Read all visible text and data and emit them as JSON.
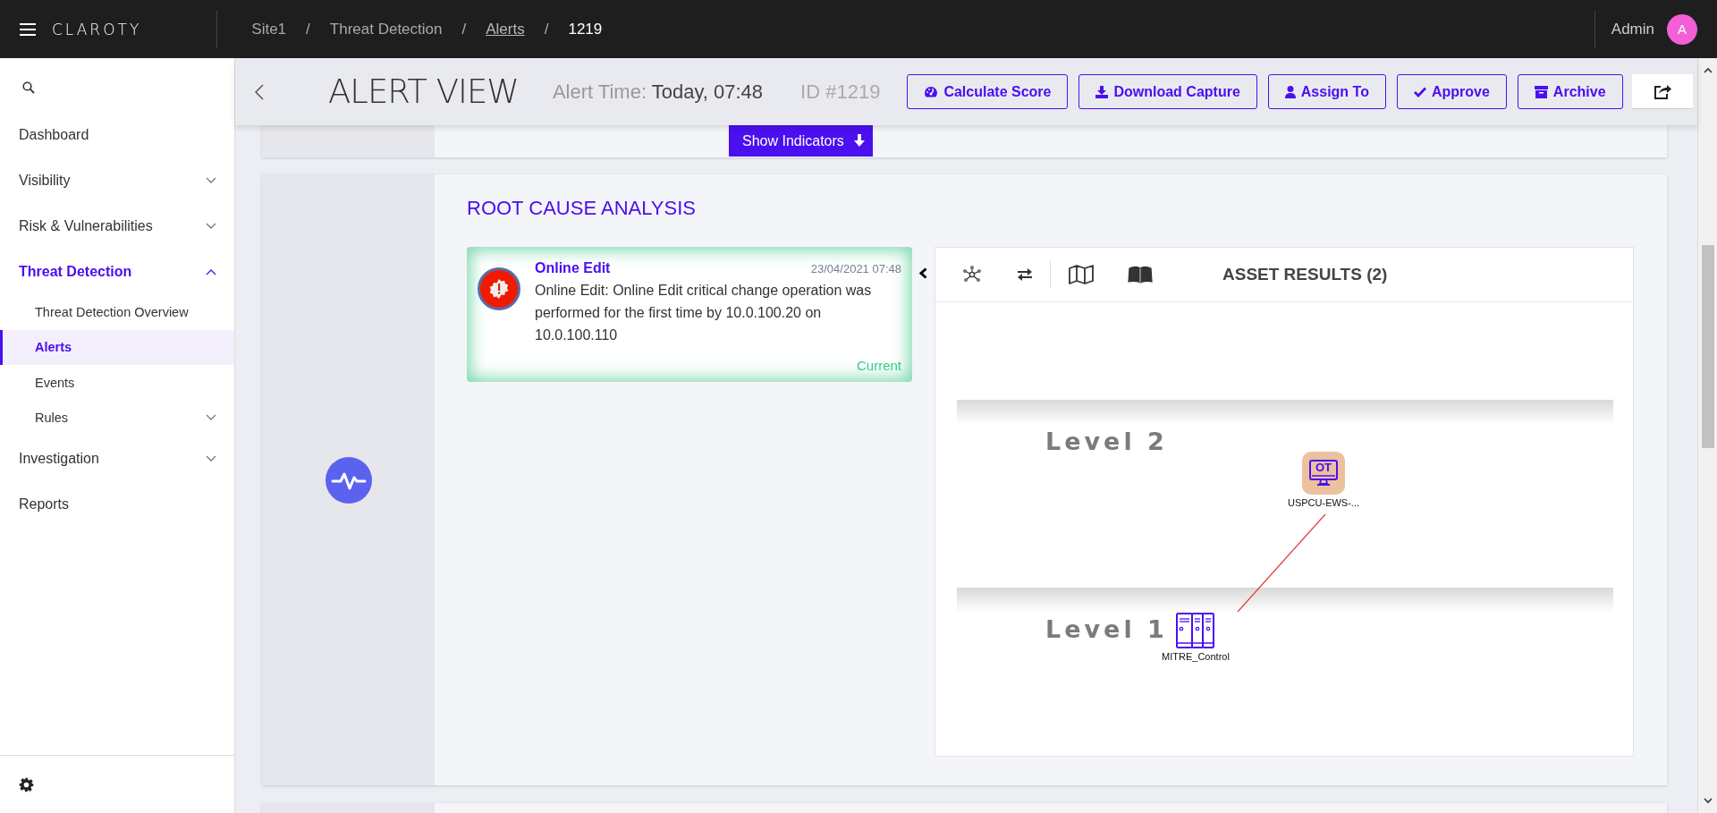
{
  "top_bar": {
    "logo": "CLAROTY",
    "separator": "/",
    "breadcrumbs": [
      {
        "label": "Site1",
        "kind": "text"
      },
      {
        "label": "Threat Detection",
        "kind": "text"
      },
      {
        "label": "Alerts",
        "kind": "link"
      },
      {
        "label": "1219",
        "kind": "current"
      }
    ],
    "user": {
      "name": "Admin",
      "initial": "A"
    }
  },
  "sidebar": {
    "items": [
      {
        "label": "Dashboard",
        "kind": "link",
        "selected": false
      },
      {
        "label": "Visibility",
        "kind": "group",
        "selected": false,
        "expanded": false
      },
      {
        "label": "Risk & Vulnerabilities",
        "kind": "group",
        "selected": false,
        "expanded": false
      },
      {
        "label": "Threat Detection",
        "kind": "group",
        "selected": true,
        "expanded": true,
        "children": [
          {
            "label": "Threat Detection Overview",
            "kind": "link",
            "selected": false
          },
          {
            "label": "Alerts",
            "kind": "link",
            "selected": true
          },
          {
            "label": "Events",
            "kind": "link",
            "selected": false
          },
          {
            "label": "Rules",
            "kind": "group",
            "selected": false,
            "expanded": false
          }
        ]
      },
      {
        "label": "Investigation",
        "kind": "group",
        "selected": false,
        "expanded": false
      },
      {
        "label": "Reports",
        "kind": "link",
        "selected": false
      }
    ]
  },
  "header": {
    "title": "ALERT VIEW",
    "time_label": "Alert Time:",
    "time_value": "Today, 07:48",
    "id": "ID #1219",
    "actions": [
      {
        "label": "Calculate Score",
        "kind": "gauge"
      },
      {
        "label": "Download Capture",
        "kind": "download"
      },
      {
        "label": "Assign To",
        "kind": "user"
      },
      {
        "label": "Approve",
        "kind": "check"
      },
      {
        "label": "Archive",
        "kind": "archive"
      },
      {
        "kind": "share"
      }
    ],
    "show_indicators": "Show Indicators"
  },
  "root_cause": {
    "heading": "ROOT CAUSE ANALYSIS",
    "alert": {
      "title": "Online Edit",
      "timestamp": "23/04/2021 07:48",
      "description": "Online Edit: Online Edit critical change operation was performed for the first time by 10.0.100.20 on 10.0.100.110",
      "status": "Current"
    },
    "asset_panel": {
      "title": "ASSET RESULTS (2)",
      "levels": [
        {
          "label": "Level 2",
          "nodes": [
            {
              "label": "USPCU-EWS-...",
              "kind": "workstation",
              "badge": "OT"
            }
          ]
        },
        {
          "label": "Level 1",
          "nodes": [
            {
              "label": "MITRE_Control",
              "kind": "server"
            }
          ]
        }
      ]
    }
  }
}
